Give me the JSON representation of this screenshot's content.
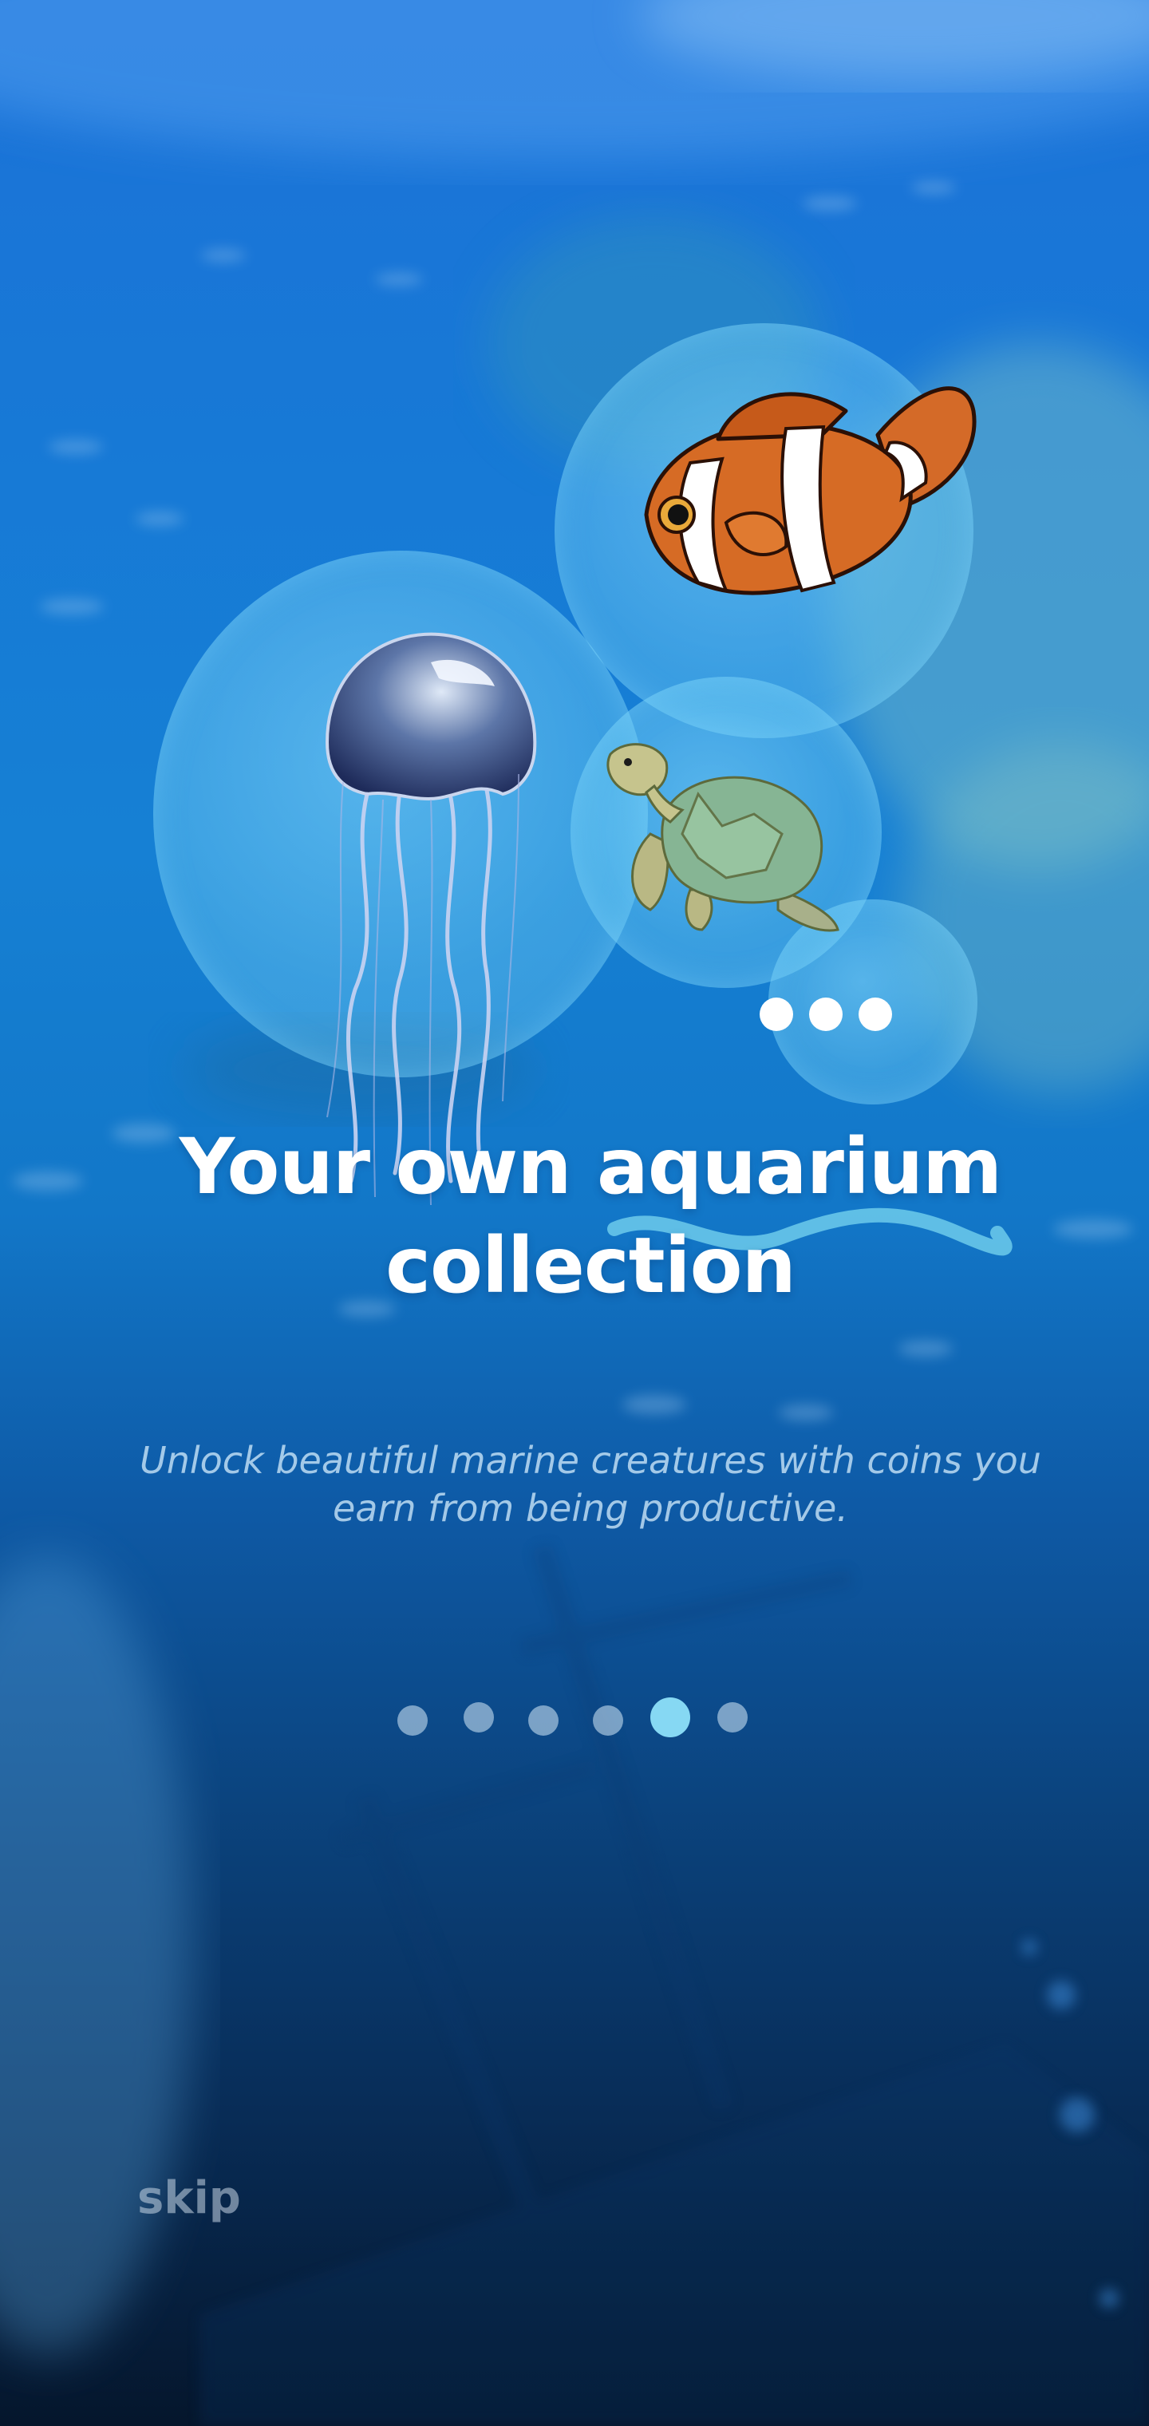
{
  "onboarding": {
    "title": "Your own aquarium collection",
    "subtitle": "Unlock beautiful marine creatures with coins you earn from being productive.",
    "skip_label": "skip",
    "page_indicator": {
      "total": 6,
      "current": 5
    }
  },
  "creatures": [
    "clownfish-icon",
    "jellyfish-icon",
    "sea-turtle-icon"
  ],
  "colors": {
    "accent": "#86d8f3",
    "title": "#ffffff",
    "skip": "#c8d7e6"
  }
}
